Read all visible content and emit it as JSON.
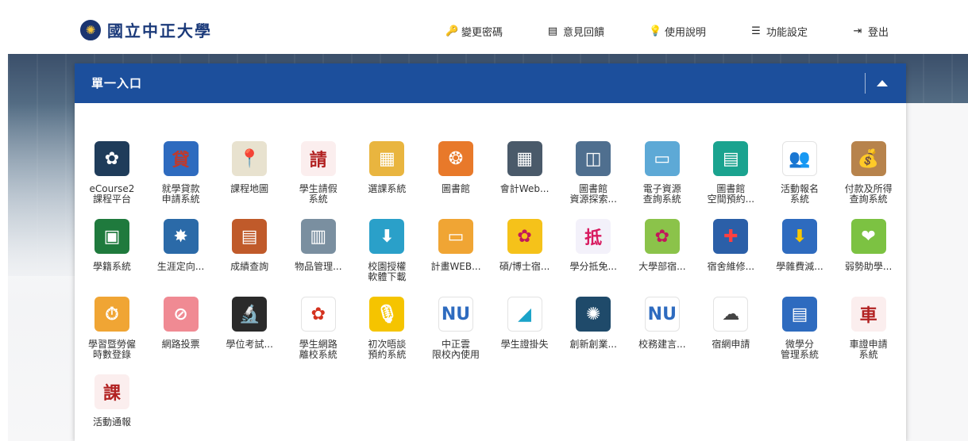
{
  "header": {
    "logo_text": "國立中正大學",
    "nav": [
      {
        "label": "變更密碼",
        "icon": "key-icon",
        "glyph": "🔑"
      },
      {
        "label": "意見回饋",
        "icon": "list-icon",
        "glyph": "▤"
      },
      {
        "label": "使用說明",
        "icon": "lightbulb-icon",
        "glyph": "💡"
      },
      {
        "label": "功能設定",
        "icon": "sliders-icon",
        "glyph": "☰"
      },
      {
        "label": "登出",
        "icon": "logout-icon",
        "glyph": "⇥"
      }
    ]
  },
  "panel": {
    "title": "單一入口",
    "header_color": "#1c4f9c"
  },
  "apps": [
    {
      "label": "eCourse2\n課程平台",
      "icon": "ecourse-icon",
      "color": "#1f3c5a",
      "glyph": "✿"
    },
    {
      "label": "就學貸款\n申請系統",
      "icon": "loan-icon",
      "color": "#2e6bbf",
      "glyph": "貸",
      "text_color": "#c0392b"
    },
    {
      "label": "課程地圖",
      "icon": "map-pin-icon",
      "color": "#e8e2cf",
      "glyph": "📍"
    },
    {
      "label": "學生請假\n系統",
      "icon": "student-leave-icon",
      "color": "#fbeeee",
      "glyph": "請",
      "text_color": "#b22222"
    },
    {
      "label": "選課系統",
      "icon": "course-select-icon",
      "color": "#e9b53f",
      "glyph": "▦"
    },
    {
      "label": "圖書館",
      "icon": "library-icon",
      "color": "#e8792a",
      "glyph": "❂"
    },
    {
      "label": "會計Web...",
      "icon": "calculator-icon",
      "color": "#4a5a6a",
      "glyph": "▦"
    },
    {
      "label": "圖書館\n資源探索...",
      "icon": "library-resource-icon",
      "color": "#4f6f8f",
      "glyph": "◫"
    },
    {
      "label": "電子資源\n查詢系統",
      "icon": "e-resource-icon",
      "color": "#5da9d6",
      "glyph": "▭"
    },
    {
      "label": "圖書館\n空間預約...",
      "icon": "space-booking-icon",
      "color": "#1aa38f",
      "glyph": "▤"
    },
    {
      "label": "活動報名\n系統",
      "icon": "people-icon",
      "color": "#ffffff",
      "glyph": "👥",
      "text_color": "#2e6bbf"
    },
    {
      "label": "付款及所得\n查詢系統",
      "icon": "money-bag-icon",
      "color": "#b7834c",
      "glyph": "💰"
    },
    {
      "label": "學籍系統",
      "icon": "school-bag-icon",
      "color": "#1f7a3d",
      "glyph": "▣"
    },
    {
      "label": "生涯定向...",
      "icon": "career-compass-icon",
      "color": "#2b6aa8",
      "glyph": "✸"
    },
    {
      "label": "成績查詢",
      "icon": "report-card-icon",
      "color": "#c05a2a",
      "glyph": "▤"
    },
    {
      "label": "物品管理...",
      "icon": "binders-icon",
      "color": "#7a8fa0",
      "glyph": "▥"
    },
    {
      "label": "校園授權\n軟體下載",
      "icon": "download-icon",
      "color": "#2aa0c9",
      "glyph": "⬇"
    },
    {
      "label": "計畫WEB...",
      "icon": "project-web-icon",
      "color": "#f0a534",
      "glyph": "▭"
    },
    {
      "label": "碩/博士宿...",
      "icon": "graduate-dorm-icon",
      "color": "#f5c21a",
      "glyph": "✿",
      "text_color": "#c2185b"
    },
    {
      "label": "學分抵免...",
      "icon": "credit-waiver-icon",
      "color": "#f3f1fa",
      "glyph": "抵",
      "text_color": "#d81b60"
    },
    {
      "label": "大學部宿...",
      "icon": "undergrad-dorm-icon",
      "color": "#8bc34a",
      "glyph": "✿",
      "text_color": "#c2185b"
    },
    {
      "label": "宿舍維修...",
      "icon": "dorm-repair-icon",
      "color": "#2b5fa8",
      "glyph": "✚",
      "text_color": "#ff4040"
    },
    {
      "label": "學雜費減...",
      "icon": "fee-reduction-icon",
      "color": "#2e6bbf",
      "glyph": "⬇",
      "text_color": "#f7c600"
    },
    {
      "label": "弱勢助學...",
      "icon": "aid-icon",
      "color": "#7cc242",
      "glyph": "❤"
    },
    {
      "label": "學習暨勞僱\n時數登錄",
      "icon": "work-hours-icon",
      "color": "#f0a534",
      "glyph": "⏱"
    },
    {
      "label": "網路投票",
      "icon": "vote-icon",
      "color": "#f08a93",
      "glyph": "⊘"
    },
    {
      "label": "學位考試...",
      "icon": "microscope-icon",
      "color": "#2a2a2a",
      "glyph": "🔬"
    },
    {
      "label": "學生網路\n離校系統",
      "icon": "flower-icon",
      "color": "#ffffff",
      "glyph": "✿",
      "text_color": "#d4321f"
    },
    {
      "label": "初次晤談\n預約系統",
      "icon": "microphone-icon",
      "color": "#f5c400",
      "glyph": "🎙"
    },
    {
      "label": "中正雲\n限校內使用",
      "icon": "ccu-cloud-icon",
      "color": "#ffffff",
      "glyph": "NU",
      "text_color": "#2e6bbf"
    },
    {
      "label": "學生證掛失",
      "icon": "student-card-icon",
      "color": "#ffffff",
      "glyph": "◢",
      "text_color": "#1aa3c9"
    },
    {
      "label": "創新創業...",
      "icon": "innovation-icon",
      "color": "#1f4a6a",
      "glyph": "✺"
    },
    {
      "label": "校務建言...",
      "icon": "suggestion-icon",
      "color": "#ffffff",
      "glyph": "NU",
      "text_color": "#2e6bbf"
    },
    {
      "label": "宿網申請",
      "icon": "internet-icon",
      "color": "#ffffff",
      "glyph": "☁",
      "text_color": "#444444"
    },
    {
      "label": "微學分\n管理系統",
      "icon": "micro-credit-icon",
      "color": "#2e6bbf",
      "glyph": "▤"
    },
    {
      "label": "車證申請\n系統",
      "icon": "car-permit-icon",
      "color": "#fbeeee",
      "glyph": "車",
      "text_color": "#b22222"
    },
    {
      "label": "活動通報",
      "icon": "activity-notice-icon",
      "color": "#fbeeee",
      "glyph": "課",
      "text_color": "#b22222"
    }
  ]
}
